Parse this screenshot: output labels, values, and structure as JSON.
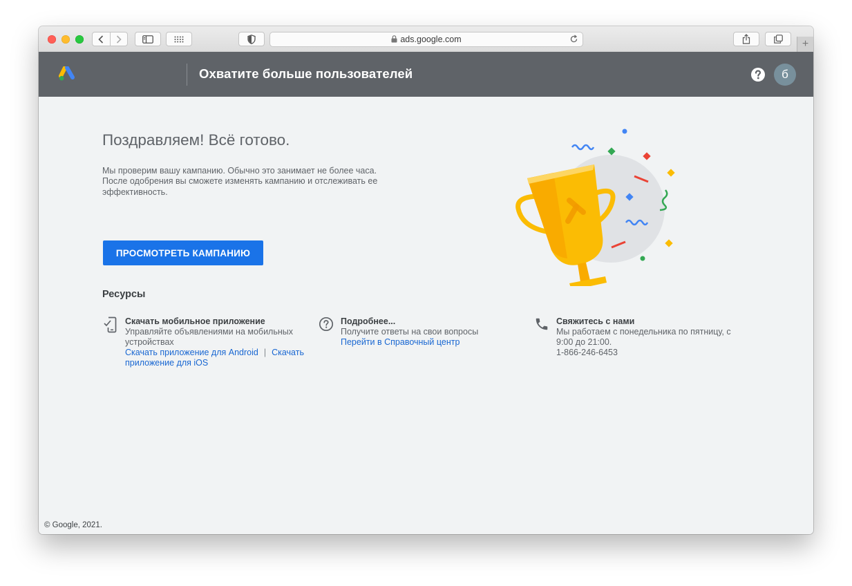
{
  "browser": {
    "url": "ads.google.com",
    "new_tab_label": "+"
  },
  "header": {
    "title": "Охватите больше пользователей",
    "avatar_letter": "б"
  },
  "main": {
    "heading": "Поздравляем! Всё готово.",
    "description_line1": "Мы проверим вашу кампанию. Обычно это занимает не более часа.",
    "description_line2": "После одобрения вы сможете изменять кампанию и отслеживать ее эффективность.",
    "cta_label": "ПРОСМОТРЕТЬ КАМПАНИЮ"
  },
  "resources": {
    "title": "Ресурсы",
    "items": [
      {
        "icon": "mobile-app-icon",
        "title": "Скачать мобильное приложение",
        "text": "Управляйте объявлениями на мобильных устройствах",
        "link_android": "Скачать приложение для Android",
        "separator": "|",
        "link_ios": "Скачать приложение для iOS"
      },
      {
        "icon": "help-circle-icon",
        "title": "Подробнее...",
        "text": "Получите ответы на свои вопросы",
        "link": "Перейти в Справочный центр"
      },
      {
        "icon": "phone-icon",
        "title": "Свяжитесь с нами",
        "text": "Мы работаем с понедельника по пятницу, с 9:00 до 21:00.",
        "phone": "1-866-246-6453"
      }
    ]
  },
  "footer": {
    "copyright": "© Google, 2021."
  },
  "colors": {
    "header_bg": "#5f6368",
    "page_bg": "#f1f3f4",
    "primary": "#1a73e8",
    "link": "#1967d2",
    "trophy": "#fbbc04"
  }
}
